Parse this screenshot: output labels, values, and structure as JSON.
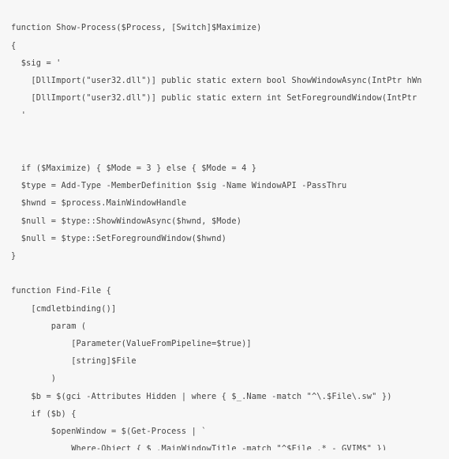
{
  "code": {
    "lines": [
      "function Show-Process($Process, [Switch]$Maximize)",
      "{",
      "  $sig = '",
      "    [DllImport(\"user32.dll\")] public static extern bool ShowWindowAsync(IntPtr hWn",
      "    [DllImport(\"user32.dll\")] public static extern int SetForegroundWindow(IntPtr ",
      "  '",
      "",
      "",
      "  if ($Maximize) { $Mode = 3 } else { $Mode = 4 }",
      "  $type = Add-Type -MemberDefinition $sig -Name WindowAPI -PassThru",
      "  $hwnd = $process.MainWindowHandle",
      "  $null = $type::ShowWindowAsync($hwnd, $Mode)",
      "  $null = $type::SetForegroundWindow($hwnd)",
      "}",
      "",
      "function Find-File {",
      "    [cmdletbinding()]",
      "        param (",
      "            [Parameter(ValueFromPipeline=$true)]",
      "            [string]$File",
      "        )",
      "    $b = $(gci -Attributes Hidden | where { $_.Name -match \"^\\.$File\\.sw\" })",
      "    if ($b) {",
      "        $openWindow = $(Get-Process | `",
      "            Where-Object { $_.MainWindowTitle -match \"^$File .* - GVIM$\" })"
    ]
  }
}
